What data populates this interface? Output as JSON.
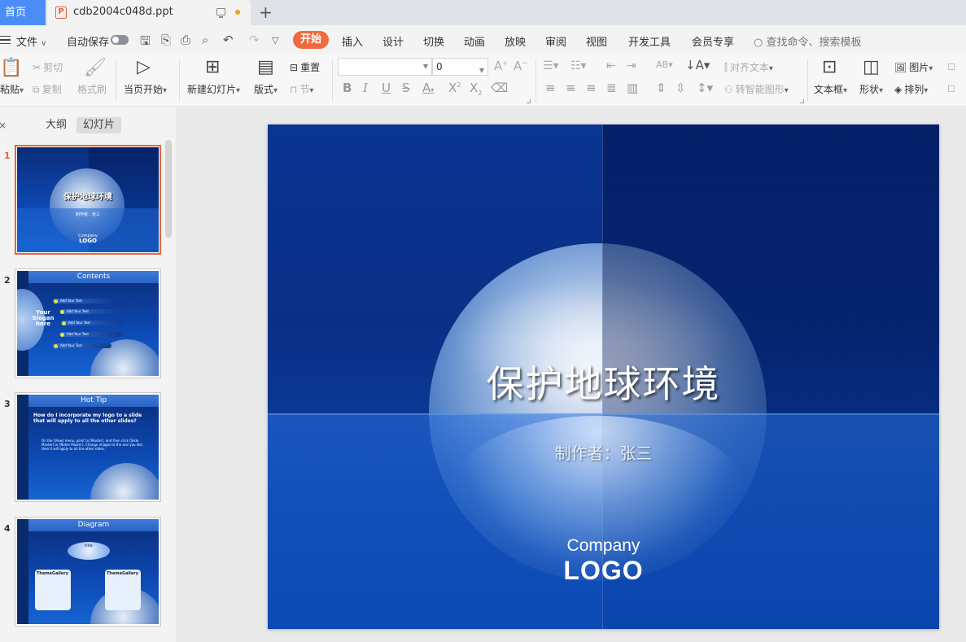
{
  "tabs": {
    "home": "首页",
    "document": "cdb2004c048d.ppt"
  },
  "menu": {
    "file": "文件",
    "autosave": "自动保存",
    "items": [
      "开始",
      "插入",
      "设计",
      "切换",
      "动画",
      "放映",
      "审阅",
      "视图",
      "开发工具",
      "会员专享"
    ],
    "search": "查找命令、搜索模板"
  },
  "ribbon": {
    "paste": "粘贴",
    "cut": "剪切",
    "copy": "复制",
    "format_painter": "格式刷",
    "from_current": "当页开始",
    "new_slide": "新建幻灯片",
    "layout": "版式",
    "reset": "重置",
    "section": "节",
    "font_size": "0",
    "align_text": "对齐文本",
    "smartart": "转智能图形",
    "textbox": "文本框",
    "shape": "形状",
    "picture": "图片",
    "arrange": "排列"
  },
  "panel": {
    "outline_tab": "大纲",
    "slides_tab": "幻灯片",
    "close": "×"
  },
  "thumbnails": [
    {
      "num": "1",
      "title": "保护地球环境",
      "subtitle": "制作者：张三",
      "company": "Company",
      "logo": "LOGO"
    },
    {
      "num": "2",
      "title": "Contents",
      "slogan": "Your Slogan here",
      "bullets": [
        "Add Your Text",
        "Add Your Text",
        "Add Your Text",
        "Add Your Text",
        "Add Your Text"
      ]
    },
    {
      "num": "3",
      "title": "Hot Tip",
      "question": "How do I incorporate my logo to a slide that will apply to all the other slides?",
      "answer": "On the [View] menu, point to [Master], and then click [Slide Master] or [Notes Master]. Change images to the one you like, then it will apply to all the other slides."
    },
    {
      "num": "4",
      "title": "Diagram",
      "center": "title",
      "box_title": "ThemeGallery"
    }
  ],
  "slide": {
    "title": "保护地球环境",
    "subtitle": "制作者：张三",
    "company": "Company",
    "logo": "LOGO"
  },
  "colors": {
    "accent": "#f06a3d",
    "home_tab": "#4b8df8",
    "slide_bg": "#0a3592"
  }
}
